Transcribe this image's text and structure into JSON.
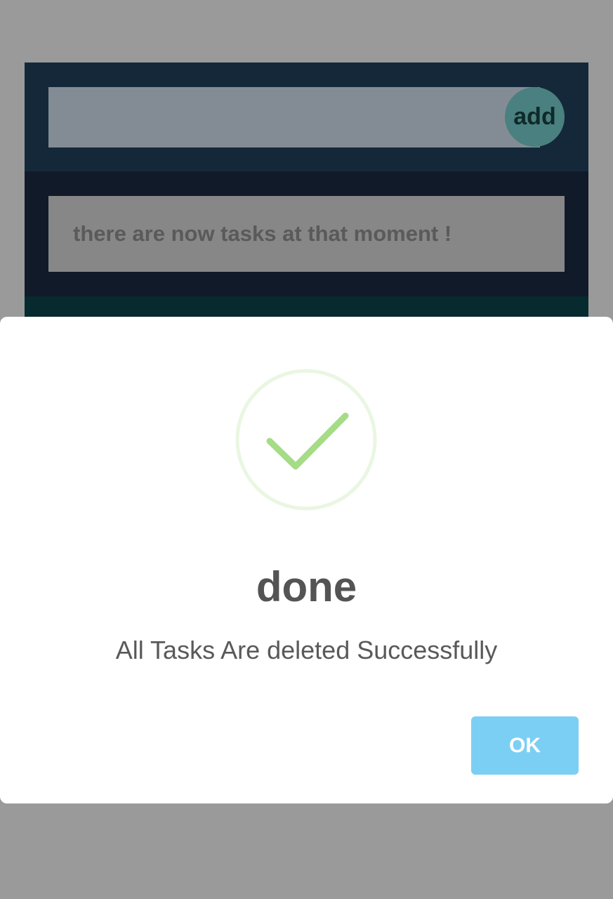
{
  "app": {
    "task_input": {
      "value": "",
      "placeholder": ""
    },
    "add_label": "add",
    "empty_message": "there are now tasks at that moment !"
  },
  "dialog": {
    "icon": "success-check-icon",
    "title": "done",
    "text": "All Tasks Are deleted Successfully",
    "ok_label": "OK"
  },
  "colors": {
    "overlay": "#9a9a9a",
    "app_header": "#14283a",
    "tasks_area": "#111a29",
    "add_button": "#4a807f",
    "check_green": "#a5dc86",
    "ok_button": "#7ccff4"
  }
}
